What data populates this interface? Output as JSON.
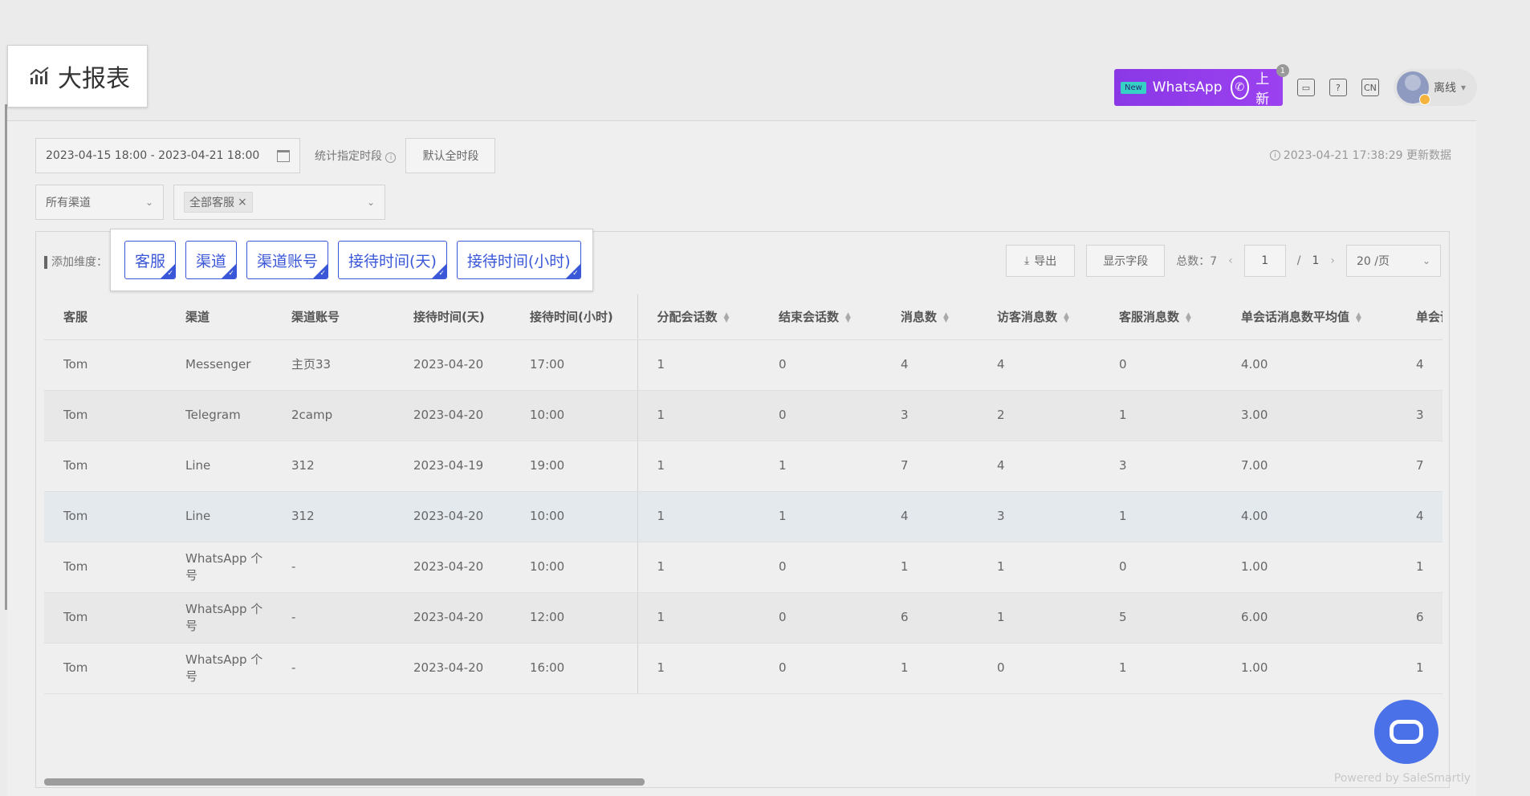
{
  "page": {
    "title": "大报表"
  },
  "topbar": {
    "banner_new": "New",
    "banner_text": "WhatsApp",
    "banner_suffix": "上新",
    "banner_badge": "1",
    "lang": "CN",
    "user_status": "离线"
  },
  "filters": {
    "date_range": "2023-04-15 18:00 - 2023-04-21 18:00",
    "stat_label": "统计指定时段",
    "default_btn": "默认全时段",
    "update_note": "2023-04-21 17:38:29 更新数据",
    "channel_select": "所有渠道",
    "agent_tag": "全部客服"
  },
  "dimensions": {
    "label": "添加维度：",
    "items": [
      "客服",
      "渠道",
      "渠道账号",
      "接待时间(天)",
      "接待时间(小时)"
    ]
  },
  "controls": {
    "export": "导出",
    "show_fields": "显示字段",
    "total": "总数：7",
    "page_current": "1",
    "page_sep": "/",
    "page_total": "1",
    "page_size": "20 /页"
  },
  "table": {
    "columns": [
      "客服",
      "渠道",
      "渠道账号",
      "接待时间(天)",
      "接待时间(小时)",
      "分配会话数",
      "结束会话数",
      "消息数",
      "访客消息数",
      "客服消息数",
      "单会话消息数平均值",
      "单会话"
    ],
    "rows": [
      [
        "Tom",
        "Messenger",
        "主页33",
        "2023-04-20",
        "17:00",
        "1",
        "0",
        "4",
        "4",
        "0",
        "4.00",
        "4"
      ],
      [
        "Tom",
        "Telegram",
        "2camp",
        "2023-04-20",
        "10:00",
        "1",
        "0",
        "3",
        "2",
        "1",
        "3.00",
        "3"
      ],
      [
        "Tom",
        "Line",
        "312",
        "2023-04-19",
        "19:00",
        "1",
        "1",
        "7",
        "4",
        "3",
        "7.00",
        "7"
      ],
      [
        "Tom",
        "Line",
        "312",
        "2023-04-20",
        "10:00",
        "1",
        "1",
        "4",
        "3",
        "1",
        "4.00",
        "4"
      ],
      [
        "Tom",
        "WhatsApp 个号",
        "-",
        "2023-04-20",
        "10:00",
        "1",
        "0",
        "1",
        "1",
        "0",
        "1.00",
        "1"
      ],
      [
        "Tom",
        "WhatsApp 个号",
        "-",
        "2023-04-20",
        "12:00",
        "1",
        "0",
        "6",
        "1",
        "5",
        "6.00",
        "6"
      ],
      [
        "Tom",
        "WhatsApp 个号",
        "-",
        "2023-04-20",
        "16:00",
        "1",
        "0",
        "1",
        "0",
        "1",
        "1.00",
        "1"
      ]
    ]
  },
  "footer": {
    "powered": "Powered by SaleSmartly"
  }
}
